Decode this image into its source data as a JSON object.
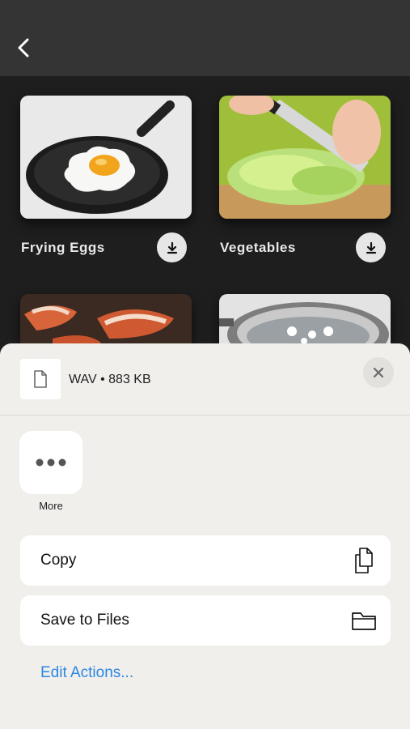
{
  "header": {
    "back_icon": "chevron-left-icon"
  },
  "cards": [
    {
      "label": "Frying Eggs",
      "download_icon": "download-icon"
    },
    {
      "label": "Vegetables",
      "download_icon": "download-icon"
    },
    {
      "label": "",
      "image": "bacon"
    },
    {
      "label": "",
      "image": "boiling-water"
    }
  ],
  "share_sheet": {
    "file_info": "WAV • 883 KB",
    "file_icon": "document-icon",
    "close_icon": "close-icon",
    "more_label": "More",
    "actions": [
      {
        "label": "Copy",
        "icon": "copy-icon"
      },
      {
        "label": "Save to Files",
        "icon": "folder-icon"
      }
    ],
    "edit_actions_label": "Edit Actions..."
  },
  "colors": {
    "accent": "#2b87e0",
    "sheet_background": "#f1efec",
    "app_background": "#1e1e1e"
  }
}
